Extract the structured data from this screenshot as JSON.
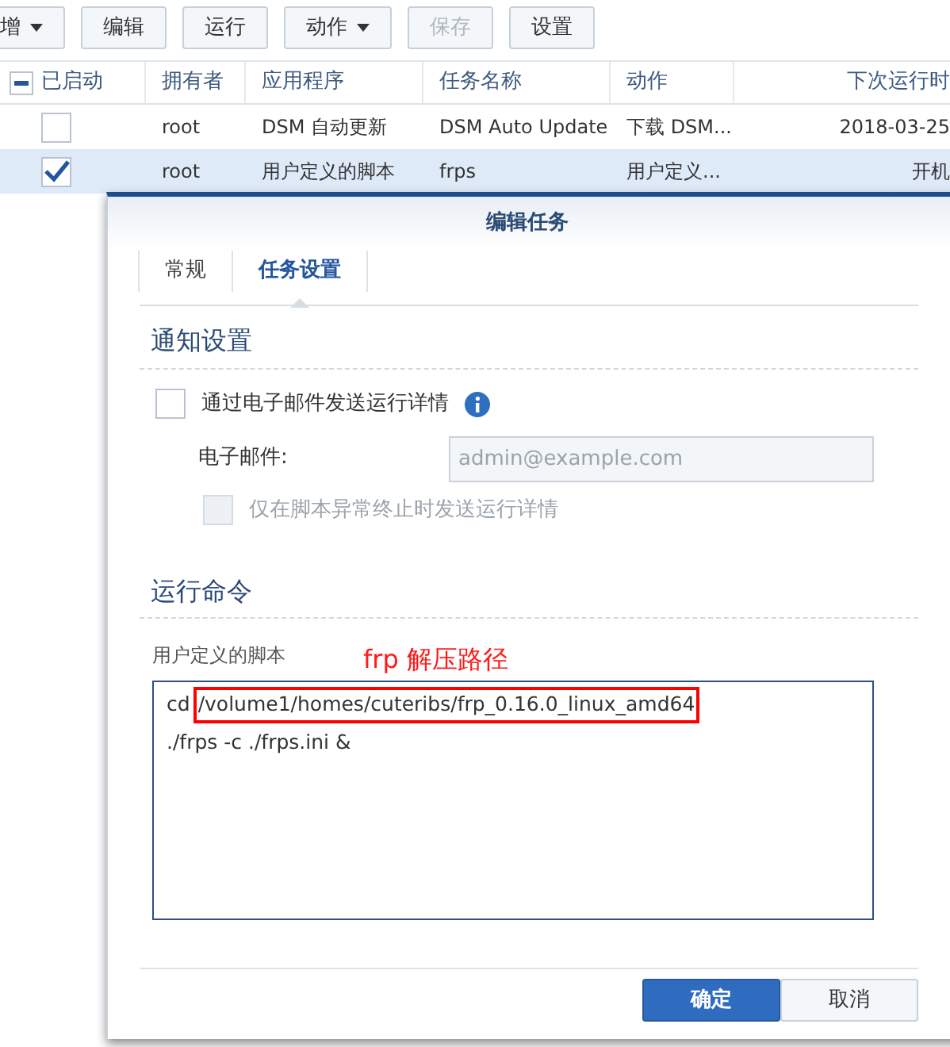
{
  "toolbar": [
    {
      "label": "增",
      "dropdown": true,
      "disabled": false
    },
    {
      "label": "编辑",
      "dropdown": false,
      "disabled": false
    },
    {
      "label": "运行",
      "dropdown": false,
      "disabled": false
    },
    {
      "label": "动作",
      "dropdown": true,
      "disabled": false
    },
    {
      "label": "保存",
      "dropdown": false,
      "disabled": true
    },
    {
      "label": "设置",
      "dropdown": false,
      "disabled": false
    }
  ],
  "table": {
    "select_all_partial": true,
    "columns": [
      "已启动",
      "拥有者",
      "应用程序",
      "任务名称",
      "动作",
      "下次运行时"
    ],
    "rows": [
      {
        "enabled": false,
        "selected": false,
        "owner": "root",
        "application": "DSM 自动更新",
        "task_name": "DSM Auto Update",
        "action": "下载 DSM...",
        "next_run": "2018-03-25"
      },
      {
        "enabled": true,
        "selected": true,
        "owner": "root",
        "application": "用户定义的脚本",
        "task_name": "frps",
        "action": "用户定义...",
        "next_run": "开机"
      }
    ]
  },
  "dialog": {
    "title": "编辑任务",
    "tabs": [
      {
        "label": "常规",
        "selected": false
      },
      {
        "label": "任务设置",
        "selected": true
      }
    ],
    "notify": {
      "heading": "通知设置",
      "send_email": {
        "label": "通过电子邮件发送运行详情",
        "checked": false
      },
      "email": {
        "label": "电子邮件:",
        "placeholder": "admin@example.com"
      },
      "only_abnormal": {
        "label": "仅在脚本异常终止时发送运行详情",
        "checked": false,
        "disabled": true
      }
    },
    "command": {
      "heading": "运行命令",
      "label": "用户定义的脚本",
      "annotation": "frp 解压路径",
      "lines": [
        {
          "text": "cd",
          "highlight": "/volume1/homes/cuteribs/frp_0.16.0_linux_amd64"
        },
        {
          "text": "./frps -c ./frps.ini &"
        }
      ]
    },
    "buttons": [
      {
        "label": "确定",
        "kind": "primary"
      },
      {
        "label": "取消",
        "kind": "secondary"
      }
    ]
  }
}
